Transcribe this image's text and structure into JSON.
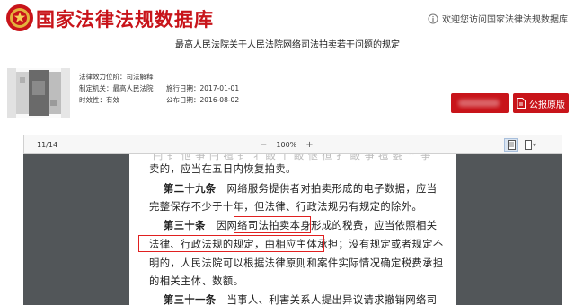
{
  "site": {
    "title": "国家法律法规数据库",
    "welcome": "欢迎您访问国家法律法规数据库"
  },
  "law": {
    "title": "最高人民法院关于人民法院网络司法拍卖若干问题的规定",
    "meta": {
      "effect_label": "法律效力位阶：",
      "effect_value": "司法解释",
      "org_label": "制定机关：",
      "org_value": "最高人民法院",
      "status_label": "时效性：",
      "status_value": "有效",
      "impl_label": "施行日期：",
      "impl_value": "2017-01-01",
      "pub_label": "公布日期：",
      "pub_value": "2016-08-02"
    },
    "pdf_button": "公报原版"
  },
  "viewer": {
    "page_indicator": "11/14",
    "zoom": "100%",
    "lines": {
      "l0": "卖的，应当在五日内恢复拍卖。",
      "a29_num": "第二十九条",
      "a29_1": "网络服务提供者对拍卖形成的电子数据，应当",
      "a29_2": "完整保存不少于十年，但法律、行政法规另有规定的除外。",
      "a30_num": "第三十条",
      "a30_1a": "因",
      "a30_1b": "网络司法拍卖",
      "a30_1c": "本身形成的税费，应当依照相关",
      "a30_2a": "法律、行政法规的规定，由相应主体承担",
      "a30_2b": "；没有规定或者规定不",
      "a30_3": "明的，人民法院可以根据法律原则和案件实际情况确定税费承担",
      "a30_4": "的相关主体、数额。",
      "a31_num": "第三十一条",
      "a31_1": "当事人、利害关系人提出异议请求撤销网络司"
    }
  }
}
